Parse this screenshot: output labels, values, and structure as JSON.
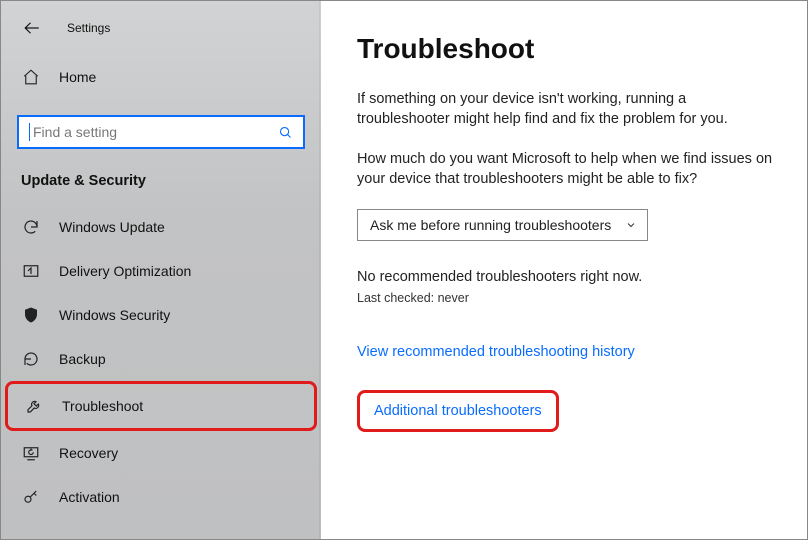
{
  "header": {
    "settings_label": "Settings"
  },
  "home_label": "Home",
  "search": {
    "placeholder": "Find a setting"
  },
  "section_title": "Update & Security",
  "sidebar_items": [
    {
      "label": "Windows Update"
    },
    {
      "label": "Delivery Optimization"
    },
    {
      "label": "Windows Security"
    },
    {
      "label": "Backup"
    },
    {
      "label": "Troubleshoot"
    },
    {
      "label": "Recovery"
    },
    {
      "label": "Activation"
    }
  ],
  "main": {
    "title": "Troubleshoot",
    "intro": "If something on your device isn't working, running a troubleshooter might help find and fix the problem for you.",
    "pref_prompt": "How much do you want Microsoft to help when we find issues on your device that troubleshooters might be able to fix?",
    "dropdown_value": "Ask me before running troubleshooters",
    "status_line": "No recommended troubleshooters right now.",
    "last_checked": "Last checked: never",
    "link_history": "View recommended troubleshooting history",
    "link_additional": "Additional troubleshooters"
  }
}
